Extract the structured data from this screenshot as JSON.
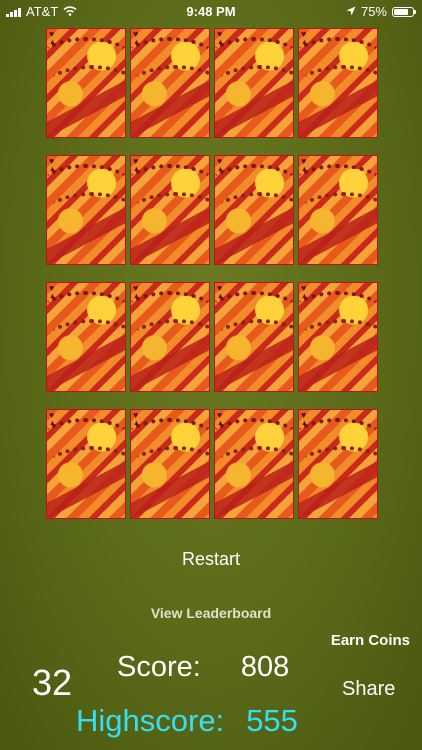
{
  "status_bar": {
    "carrier": "AT&T",
    "time": "9:48 PM",
    "battery": "75%",
    "battery_level": 0.75,
    "icons": [
      "signal-bars-icon",
      "wifi-icon",
      "location-arrow-icon",
      "battery-icon"
    ]
  },
  "board": {
    "rows": 4,
    "columns": 4,
    "cards_face_down": 16,
    "card_pip": "♥"
  },
  "controls": {
    "restart_label": "Restart",
    "leaderboard_label": "View Leaderboard",
    "earn_coins_label": "Earn Coins",
    "share_label": "Share"
  },
  "stats": {
    "timer": "32",
    "score_label": "Score:",
    "score_value": "808",
    "highscore_label": "Highscore:",
    "highscore_value": "555"
  },
  "colors": {
    "background": "#5a6a18",
    "highscore": "#34e0f0",
    "card_border": "#b4161a"
  }
}
